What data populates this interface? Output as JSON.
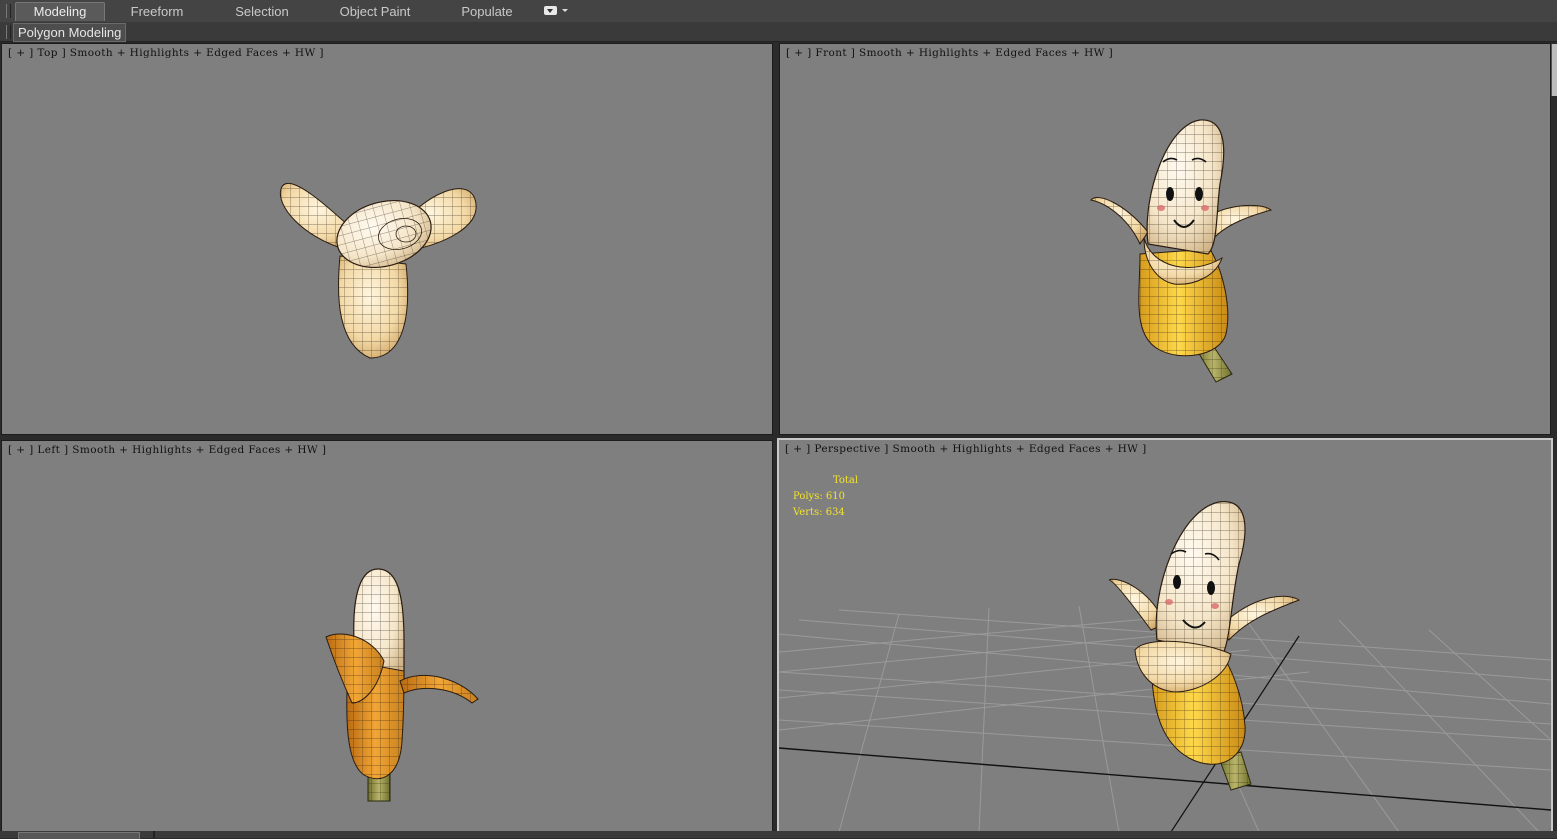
{
  "ribbon": {
    "tabs": [
      {
        "label": "Modeling",
        "active": true
      },
      {
        "label": "Freeform",
        "active": false
      },
      {
        "label": "Selection",
        "active": false
      },
      {
        "label": "Object Paint",
        "active": false
      },
      {
        "label": "Populate",
        "active": false
      }
    ],
    "panel_tab": "Polygon Modeling"
  },
  "viewports": [
    {
      "label": "[ + ] Top ] Smooth + Highlights + Edged Faces + HW ]"
    },
    {
      "label": "[ + ] Front ] Smooth + Highlights + Edged Faces + HW ]"
    },
    {
      "label": "[ + ] Left ] Smooth + Highlights + Edged Faces + HW ]"
    },
    {
      "label": "[ + ] Perspective ] Smooth + Highlights + Edged Faces + HW ]",
      "active": true
    }
  ],
  "stats": {
    "total": "Total",
    "polys": "Polys: 610",
    "verts": "Verts: 634"
  },
  "colors": {
    "viewport_bg": "#7f7f7f",
    "stats_text": "#f3e22a",
    "peel_light": "#f6e2b6",
    "banana_yellow": "#f2c23a",
    "banana_orange": "#e4962a",
    "stem": "#9a9a48"
  },
  "icons": [
    "grip-icon",
    "dropdown-icon"
  ]
}
